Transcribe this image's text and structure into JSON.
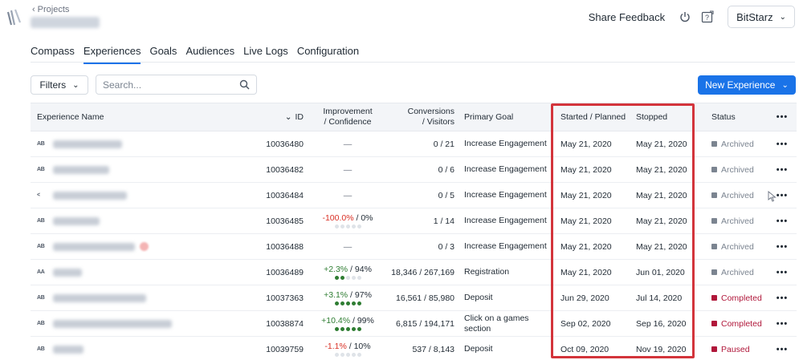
{
  "header": {
    "back_label": "Projects",
    "share_feedback": "Share Feedback",
    "account": "BitStarz"
  },
  "tabs": [
    {
      "label": "Compass",
      "active": false
    },
    {
      "label": "Experiences",
      "active": true
    },
    {
      "label": "Goals",
      "active": false
    },
    {
      "label": "Audiences",
      "active": false
    },
    {
      "label": "Live Logs",
      "active": false
    },
    {
      "label": "Configuration",
      "active": false
    }
  ],
  "toolbar": {
    "filters_label": "Filters",
    "search_placeholder": "Search...",
    "new_experience_label": "New Experience"
  },
  "table": {
    "headers": {
      "name": "Experience Name",
      "id": "ID",
      "improvement_1": "Improvement",
      "improvement_2": "/ Confidence",
      "conversions_1": "Conversions",
      "conversions_2": "/ Visitors",
      "goal": "Primary Goal",
      "started": "Started / Planned",
      "stopped": "Stopped",
      "status": "Status",
      "more": "•••"
    },
    "rows": [
      {
        "type": "AB",
        "id": "10036480",
        "improvement": "—",
        "confidence": "",
        "conversions": "0 / 21",
        "goal": "Increase Engagement",
        "started": "May 21, 2020",
        "stopped": "May 21, 2020",
        "status": "Archived"
      },
      {
        "type": "AB",
        "id": "10036482",
        "improvement": "—",
        "confidence": "",
        "conversions": "0 / 6",
        "goal": "Increase Engagement",
        "started": "May 21, 2020",
        "stopped": "May 21, 2020",
        "status": "Archived"
      },
      {
        "type": "<",
        "id": "10036484",
        "improvement": "—",
        "confidence": "",
        "conversions": "0 / 5",
        "goal": "Increase Engagement",
        "started": "May 21, 2020",
        "stopped": "May 21, 2020",
        "status": "Archived"
      },
      {
        "type": "AB",
        "id": "10036485",
        "improvement": "-100.0%",
        "confidence": " / 0%",
        "conversions": "1 / 14",
        "goal": "Increase Engagement",
        "started": "May 21, 2020",
        "stopped": "May 21, 2020",
        "status": "Archived"
      },
      {
        "type": "AB",
        "id": "10036488",
        "improvement": "—",
        "confidence": "",
        "conversions": "0 / 3",
        "goal": "Increase Engagement",
        "started": "May 21, 2020",
        "stopped": "May 21, 2020",
        "status": "Archived"
      },
      {
        "type": "AA",
        "id": "10036489",
        "improvement": "+2.3%",
        "confidence": " / 94%",
        "conversions": "18,346 / 267,169",
        "goal": "Registration",
        "started": "May 21, 2020",
        "stopped": "Jun 01, 2020",
        "status": "Archived"
      },
      {
        "type": "AB",
        "id": "10037363",
        "improvement": "+3.1%",
        "confidence": " / 97%",
        "conversions": "16,561 / 85,980",
        "goal": "Deposit",
        "started": "Jun 29, 2020",
        "stopped": "Jul 14, 2020",
        "status": "Completed"
      },
      {
        "type": "AB",
        "id": "10038874",
        "improvement": "+10.4%",
        "confidence": " / 99%",
        "conversions": "6,815 / 194,171",
        "goal": "Click on a games section",
        "started": "Sep 02, 2020",
        "stopped": "Sep 16, 2020",
        "status": "Completed"
      },
      {
        "type": "AB",
        "id": "10039759",
        "improvement": "-1.1%",
        "confidence": " / 10%",
        "conversions": "537 / 8,143",
        "goal": "Deposit",
        "started": "Oct 09, 2020",
        "stopped": "Nov 19, 2020",
        "status": "Paused"
      }
    ],
    "more_label": "•••"
  },
  "colors": {
    "accent": "#1a73e8",
    "highlight": "#d3343b",
    "positive": "#2e7d32",
    "negative": "#d93025",
    "archived": "#7b8490",
    "completed": "#b0173a"
  },
  "icons": [
    "logo-icon",
    "chevron-left-icon",
    "power-icon",
    "help-icon",
    "chevron-down-icon",
    "search-icon",
    "more-icon",
    "sort-down-icon",
    "cursor-icon"
  ]
}
